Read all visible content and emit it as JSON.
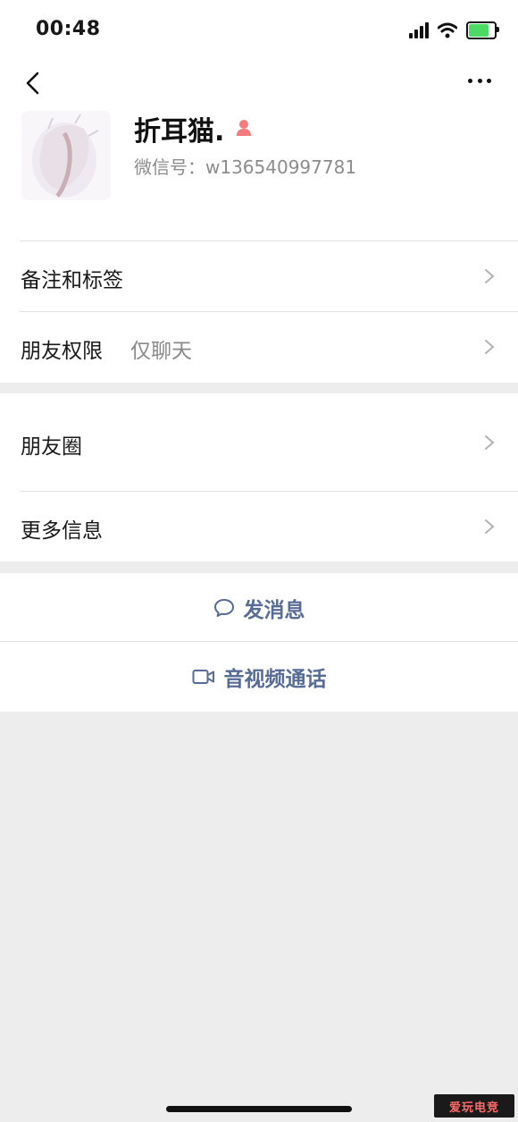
{
  "status_bar": {
    "time": "00:48",
    "battery_level": 0.8
  },
  "header": {
    "back_icon": "chevron-left-icon",
    "more_icon": "ellipsis-icon"
  },
  "profile": {
    "name": "折耳猫.",
    "wechat_id": "微信号：w136540997781",
    "gender_icon": "female-icon",
    "gender_color": "#f27c7c"
  },
  "menu": {
    "remarks_label": "备注和标签",
    "permissions_label": "朋友权限",
    "permissions_value": "仅聊天",
    "moments_label": "朋友圈",
    "more_info_label": "更多信息"
  },
  "actions": {
    "message_label": "发消息",
    "call_label": "音视频通话",
    "accent_color": "#576b95"
  },
  "watermark": {
    "text": "爱玩电竞"
  }
}
